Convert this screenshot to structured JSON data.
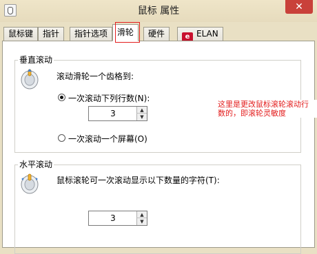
{
  "window": {
    "title": "鼠标 属性",
    "close_glyph": "✕"
  },
  "tabs": [
    {
      "label": "鼠标键"
    },
    {
      "label": "指针"
    },
    {
      "label": "指针选项"
    },
    {
      "label": "滑轮"
    },
    {
      "label": "硬件"
    },
    {
      "label": "ELAN",
      "logo": "elan-logo"
    }
  ],
  "active_tab": "滑轮",
  "vertical": {
    "group_title": "垂直滚动",
    "instruction": "滚动滑轮一个齿格到:",
    "option_lines_label": "一次滚动下列行数(N):",
    "lines_value": "3",
    "option_screen_label": "一次滚动一个屏幕(O)",
    "selected": "lines"
  },
  "horizontal": {
    "group_title": "水平滚动",
    "instruction": "鼠标滚轮可一次滚动显示以下数量的字符(T):",
    "chars_value": "3"
  },
  "annotation": {
    "line1": "这里是更改鼠标滚轮滚动行",
    "line2": "数的，即滚轮灵敏度",
    "color": "#e31c1c"
  },
  "icons": {
    "wheel": "mouse-wheel-icon",
    "app": "mouse-app-icon"
  }
}
